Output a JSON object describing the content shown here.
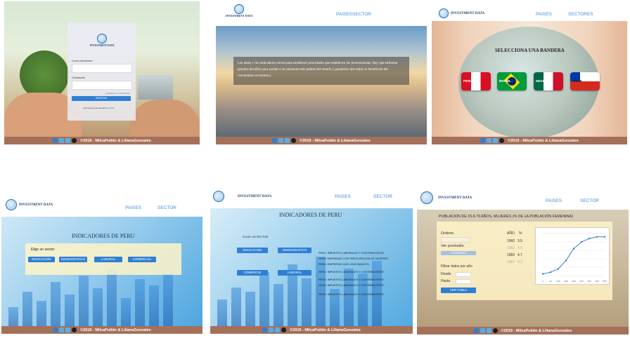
{
  "footer": {
    "text": "©2019 - MilcaPulido & LilianaGonzales",
    "icons": [
      "facebook-icon",
      "mail-icon",
      "twitter-icon",
      "github-icon"
    ]
  },
  "brand": {
    "name": "INVESTMENT DATA"
  },
  "nav": {
    "paises": "PAISES",
    "sector": "SECTOR",
    "sectores": "SECTORES"
  },
  "login": {
    "email_label": "Correo electrónico",
    "password_label": "Contraseña",
    "forgot": "¿Olvidaste tu contraseña?",
    "submit": "INGRESA",
    "register_prompt": "¿No tienes una cuenta?",
    "register_link": "Regístrate"
  },
  "hero": {
    "text": "Los datos y los indicadores sirven para establecer prioridades que establecen los inversionistas. Hay que enfrentar grandes desafíos para ayudar a las personas más pobres del mundo y garantizar que todos se beneficien del crecimiento económico."
  },
  "flags": {
    "title": "SELECCIONA UNA BANDERA",
    "items": [
      {
        "label": "PERU",
        "colors": [
          "#d91023",
          "#ffffff",
          "#d91023"
        ]
      },
      {
        "label": "BRASIL",
        "colors": [
          "#009b3a",
          "#fedf00",
          "#002776"
        ]
      },
      {
        "label": "MEXICO",
        "colors": [
          "#006847",
          "#ffffff",
          "#ce1126"
        ]
      },
      {
        "label": "CHILE",
        "colors": [
          "#0039a6",
          "#ffffff",
          "#d52b1e"
        ]
      }
    ]
  },
  "indicators1": {
    "title": "INDICADORES DE PERU",
    "prompt": "Elige un sector:",
    "sectors": [
      "EDUCACION",
      "DEMOGRAFICO",
      "LABORAL",
      "COMERCIAL"
    ]
  },
  "indicators2": {
    "title": "INDICADORES DE PERU",
    "prompt": "ELIGE UN SECTOR",
    "sectors": [
      "EDUCACION",
      "DEMOGRAFICO",
      "COMERCIO",
      "LABORAL"
    ],
    "list": [
      "PERU: IMPUESTO LABORALES Y CONTRIBUYENTE",
      "PERU: EMPRESAS CON PARTICIPACION DE MUJERES",
      "PERU: EMPRESAS QUE USAN BANCOS",
      "PERU: IMPUESTO LABORALES Y CONTRIBUYENTE",
      "PERU: IMPUESTO LABORALES Y CONTRIBUYENTE",
      "PERU: IMPUESTO LABORALES Y CONTRIBUYENTE",
      "PERU: IMPUESTO LABORALES Y CONTRIBUYENTE"
    ]
  },
  "population": {
    "title": "POBLACIÓN DE 15 A 79 AÑOS, MUJERES (% DE LA POBLACIÓN FEMENINA)",
    "order_label": "Ordene",
    "average_label": "Ver promedio",
    "average_button": "PROMEDIO",
    "filter_label": "Filtrar datos por año",
    "from_label": "Desde",
    "to_label": "Hasta",
    "table_button": "VER TABLA",
    "col_year": "AÑO",
    "col_pct": "%",
    "rows": [
      {
        "year": "1960",
        "pct": "3.5"
      },
      {
        "year": "1962",
        "pct": "4.0"
      },
      {
        "year": "1965",
        "pct": "4.7"
      },
      {
        "year": "1967",
        "pct": "5.3"
      }
    ]
  },
  "chart_data": {
    "type": "line",
    "x": [
      "0",
      "40",
      "120",
      "180",
      "260",
      "320",
      "400",
      "480",
      "550"
    ],
    "values": [
      1,
      2,
      4,
      9,
      16,
      20,
      22,
      23,
      23
    ]
  }
}
